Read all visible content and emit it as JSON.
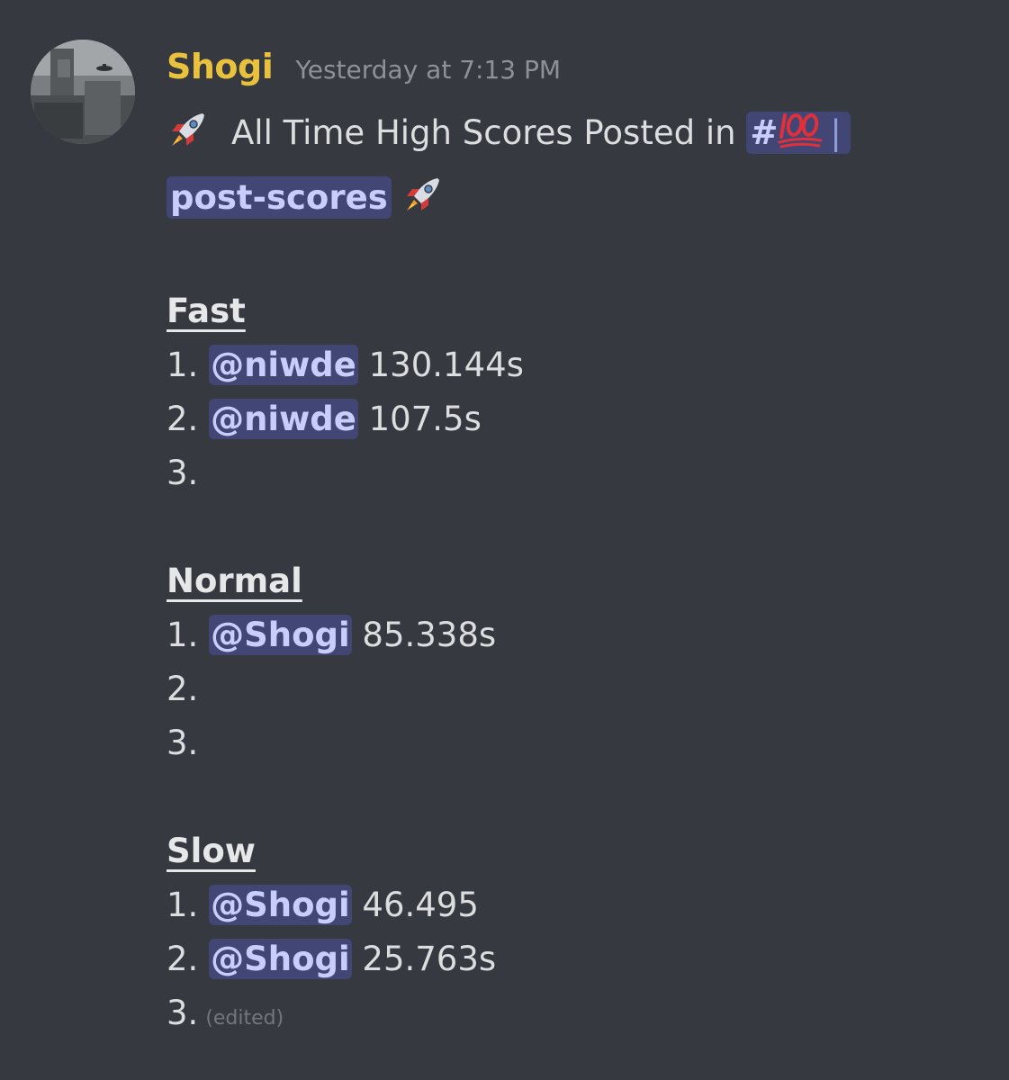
{
  "message": {
    "author": "Shogi",
    "timestamp": "Yesterday at 7:13 PM",
    "intro_text": "All Time High Scores Posted in",
    "channel_mention": {
      "hash": "#",
      "emoji": "hundred-points-emoji",
      "separator": "|",
      "name": "post-scores"
    },
    "emoji": "rocket-emoji",
    "sections": [
      {
        "title": "Fast",
        "entries": [
          {
            "rank": "1.",
            "mention": "@niwde",
            "score": "130.144s"
          },
          {
            "rank": "2.",
            "mention": "@niwde",
            "score": "107.5s"
          },
          {
            "rank": "3.",
            "mention": "",
            "score": ""
          }
        ]
      },
      {
        "title": "Normal",
        "entries": [
          {
            "rank": "1.",
            "mention": "@Shogi",
            "score": "85.338s"
          },
          {
            "rank": "2.",
            "mention": "",
            "score": ""
          },
          {
            "rank": "3.",
            "mention": "",
            "score": ""
          }
        ]
      },
      {
        "title": "Slow",
        "entries": [
          {
            "rank": "1.",
            "mention": "@Shogi",
            "score": "46.495"
          },
          {
            "rank": "2.",
            "mention": "@Shogi",
            "score": "25.763s"
          },
          {
            "rank": "3.",
            "mention": "",
            "score": ""
          }
        ]
      }
    ],
    "edited_label": "(edited)"
  },
  "colors": {
    "background": "#36393f",
    "username": "#e9c13c",
    "timestamp": "#8e9297",
    "text": "#dcddde",
    "mention_bg": "#414675",
    "mention_text": "#c9cdfb"
  }
}
